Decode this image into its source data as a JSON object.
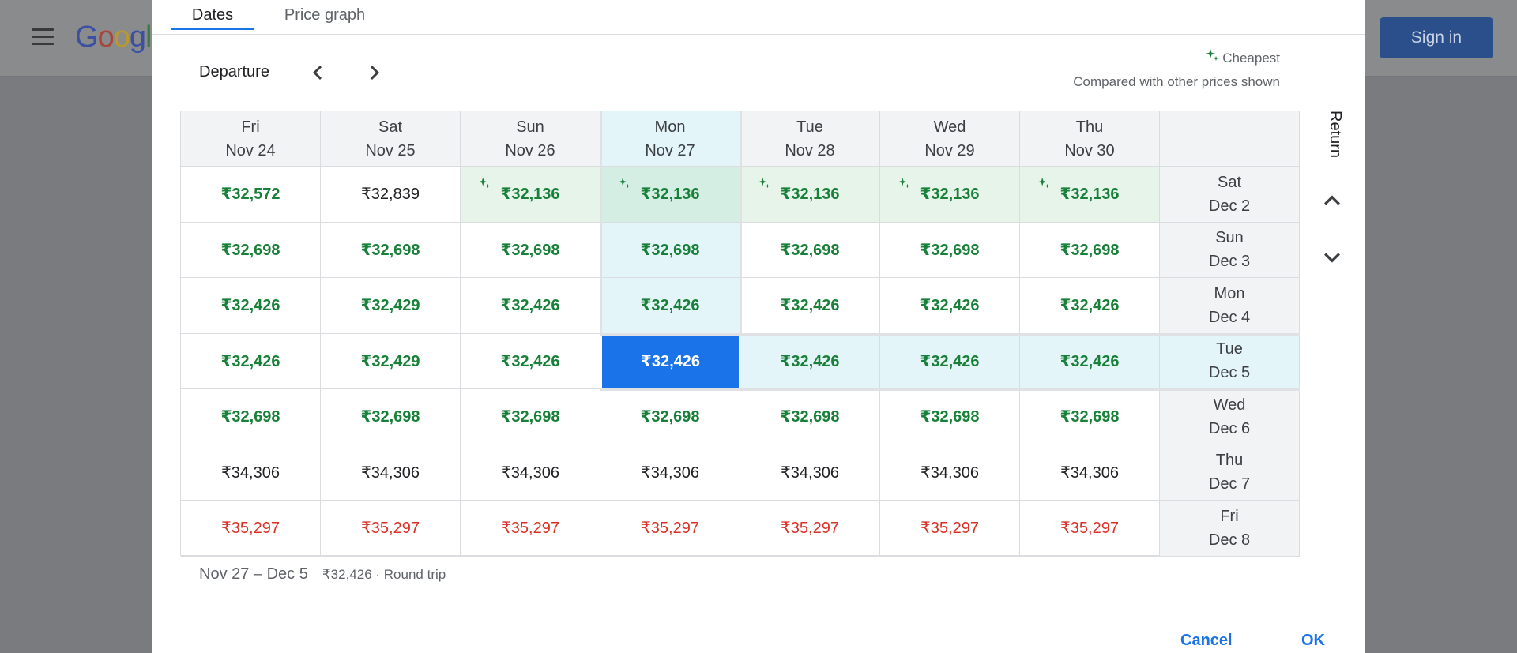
{
  "background": {
    "logo_text": "Google",
    "sign_in_label": "Sign in"
  },
  "tabs": [
    {
      "label": "Dates"
    },
    {
      "label": "Price graph"
    }
  ],
  "departure_label": "Departure",
  "legend": {
    "cheapest_label": "Cheapest",
    "note": "Compared with other prices shown"
  },
  "return_label": "Return",
  "departure_dates": [
    {
      "day": "Fri",
      "date": "Nov 24"
    },
    {
      "day": "Sat",
      "date": "Nov 25"
    },
    {
      "day": "Sun",
      "date": "Nov 26"
    },
    {
      "day": "Mon",
      "date": "Nov 27"
    },
    {
      "day": "Tue",
      "date": "Nov 28"
    },
    {
      "day": "Wed",
      "date": "Nov 29"
    },
    {
      "day": "Thu",
      "date": "Nov 30"
    }
  ],
  "return_dates": [
    {
      "day": "Sat",
      "date": "Dec 2"
    },
    {
      "day": "Sun",
      "date": "Dec 3"
    },
    {
      "day": "Mon",
      "date": "Dec 4"
    },
    {
      "day": "Tue",
      "date": "Dec 5"
    },
    {
      "day": "Wed",
      "date": "Dec 6"
    },
    {
      "day": "Thu",
      "date": "Dec 7"
    },
    {
      "day": "Fri",
      "date": "Dec 8"
    }
  ],
  "prices": [
    [
      {
        "v": "₹32,572",
        "c": "green"
      },
      {
        "v": "₹32,839",
        "c": "black"
      },
      {
        "v": "₹32,136",
        "c": "green",
        "cheapest": true
      },
      {
        "v": "₹32,136",
        "c": "green",
        "cheapest": true
      },
      {
        "v": "₹32,136",
        "c": "green",
        "cheapest": true
      },
      {
        "v": "₹32,136",
        "c": "green",
        "cheapest": true
      },
      {
        "v": "₹32,136",
        "c": "green",
        "cheapest": true
      }
    ],
    [
      {
        "v": "₹32,698",
        "c": "green"
      },
      {
        "v": "₹32,698",
        "c": "green"
      },
      {
        "v": "₹32,698",
        "c": "green"
      },
      {
        "v": "₹32,698",
        "c": "green"
      },
      {
        "v": "₹32,698",
        "c": "green"
      },
      {
        "v": "₹32,698",
        "c": "green"
      },
      {
        "v": "₹32,698",
        "c": "green"
      }
    ],
    [
      {
        "v": "₹32,426",
        "c": "green"
      },
      {
        "v": "₹32,429",
        "c": "green"
      },
      {
        "v": "₹32,426",
        "c": "green"
      },
      {
        "v": "₹32,426",
        "c": "green"
      },
      {
        "v": "₹32,426",
        "c": "green"
      },
      {
        "v": "₹32,426",
        "c": "green"
      },
      {
        "v": "₹32,426",
        "c": "green"
      }
    ],
    [
      {
        "v": "₹32,426",
        "c": "green"
      },
      {
        "v": "₹32,429",
        "c": "green"
      },
      {
        "v": "₹32,426",
        "c": "green"
      },
      {
        "v": "₹32,426",
        "c": "green",
        "selected": true
      },
      {
        "v": "₹32,426",
        "c": "green"
      },
      {
        "v": "₹32,426",
        "c": "green"
      },
      {
        "v": "₹32,426",
        "c": "green"
      }
    ],
    [
      {
        "v": "₹32,698",
        "c": "green"
      },
      {
        "v": "₹32,698",
        "c": "green"
      },
      {
        "v": "₹32,698",
        "c": "green"
      },
      {
        "v": "₹32,698",
        "c": "green"
      },
      {
        "v": "₹32,698",
        "c": "green"
      },
      {
        "v": "₹32,698",
        "c": "green"
      },
      {
        "v": "₹32,698",
        "c": "green"
      }
    ],
    [
      {
        "v": "₹34,306",
        "c": "black"
      },
      {
        "v": "₹34,306",
        "c": "black"
      },
      {
        "v": "₹34,306",
        "c": "black"
      },
      {
        "v": "₹34,306",
        "c": "black"
      },
      {
        "v": "₹34,306",
        "c": "black"
      },
      {
        "v": "₹34,306",
        "c": "black"
      },
      {
        "v": "₹34,306",
        "c": "black"
      }
    ],
    [
      {
        "v": "₹35,297",
        "c": "red"
      },
      {
        "v": "₹35,297",
        "c": "red"
      },
      {
        "v": "₹35,297",
        "c": "red"
      },
      {
        "v": "₹35,297",
        "c": "red"
      },
      {
        "v": "₹35,297",
        "c": "red"
      },
      {
        "v": "₹35,297",
        "c": "red"
      },
      {
        "v": "₹35,297",
        "c": "red"
      }
    ]
  ],
  "selection": {
    "departure_index": 3,
    "return_index": 3
  },
  "summary": {
    "dates": "Nov 27 – Dec 5",
    "price_info": "₹32,426 · Round trip"
  },
  "buttons": {
    "cancel": "Cancel",
    "ok": "OK"
  },
  "colors": {
    "accent": "#1a73e8",
    "green_price": "#188038",
    "red_price": "#d93025",
    "cheapest_bg": "#e6f4ea",
    "highlight_bg": "#e4f5fa"
  },
  "icons": {
    "menu": "hamburger-icon",
    "prev": "chevron-left-icon",
    "next": "chevron-right-icon",
    "up": "chevron-up-icon",
    "down": "chevron-down-icon",
    "cheapest": "sparkle-icon"
  }
}
